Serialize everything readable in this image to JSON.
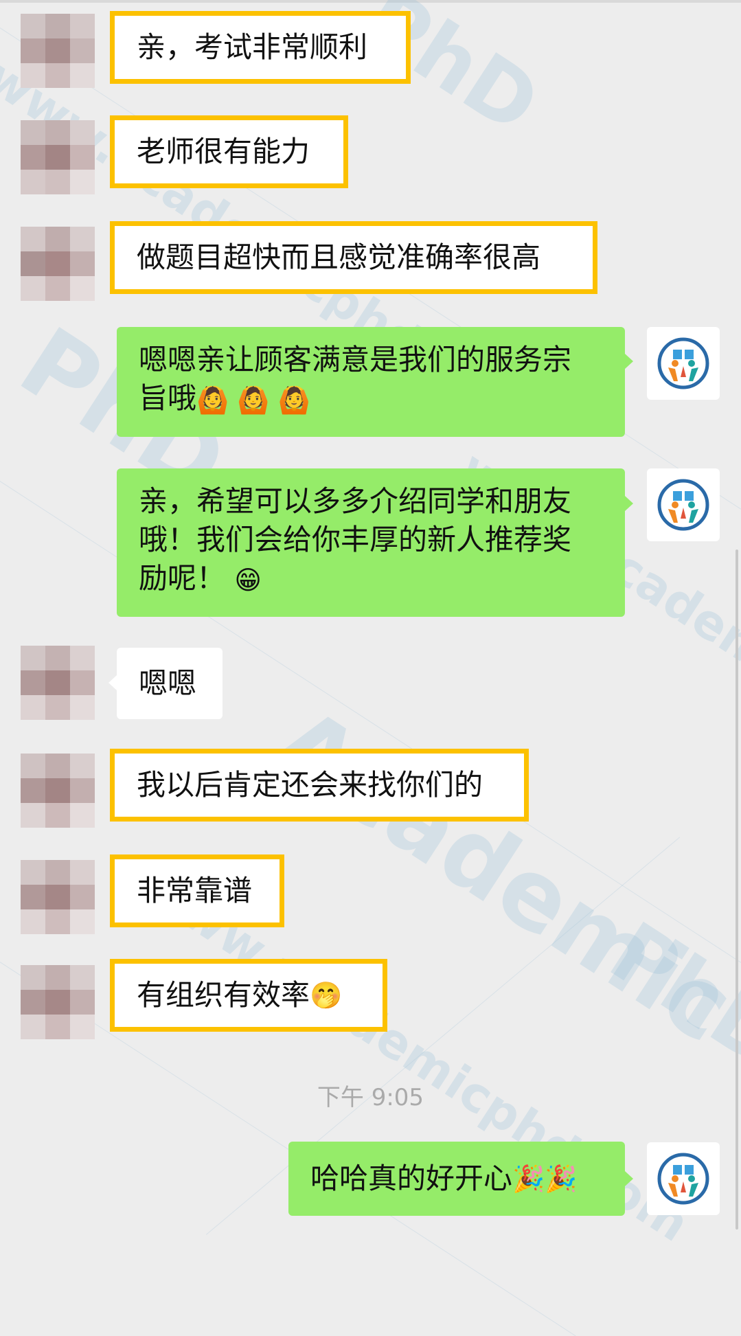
{
  "colors": {
    "background": "#ededed",
    "incoming_bubble": "#ffffff",
    "outgoing_bubble": "#95ec69",
    "highlight_border": "#fcc100"
  },
  "watermark": {
    "text_academic": "Academic",
    "text_phd": "PhD",
    "text_url": "www.academicphd.com"
  },
  "messages": [
    {
      "side": "left",
      "text": "亲，考试非常顺利",
      "highlighted": true
    },
    {
      "side": "left",
      "text": "老师很有能力",
      "highlighted": true
    },
    {
      "side": "left",
      "text": "做题目超快而且感觉准确率很高",
      "highlighted": true
    },
    {
      "side": "right",
      "text_line1": "嗯嗯亲让顾客满意是我们的服务宗",
      "text_line2": "旨哦",
      "emoji": "🙆 🙆 🙆"
    },
    {
      "side": "right",
      "text_line1": "亲，希望可以多多介绍同学和朋友",
      "text_line2": "哦！我们会给你丰厚的新人推荐奖",
      "text_line3": "励呢！",
      "emoji": "😁"
    },
    {
      "side": "left",
      "text": "嗯嗯",
      "highlighted": false
    },
    {
      "side": "left",
      "text": "我以后肯定还会来找你们的",
      "highlighted": true
    },
    {
      "side": "left",
      "text": "非常靠谱",
      "highlighted": true
    },
    {
      "side": "left",
      "text": "有组织有效率",
      "emoji": "🤭",
      "highlighted": true
    },
    {
      "side": "right",
      "text": "哈哈真的好开心",
      "emoji": "🎉🎉"
    }
  ],
  "timestamp": "下午 9:05",
  "icons": {
    "contact_avatar": "blurred-avatar",
    "own_avatar": "academic-logo"
  }
}
